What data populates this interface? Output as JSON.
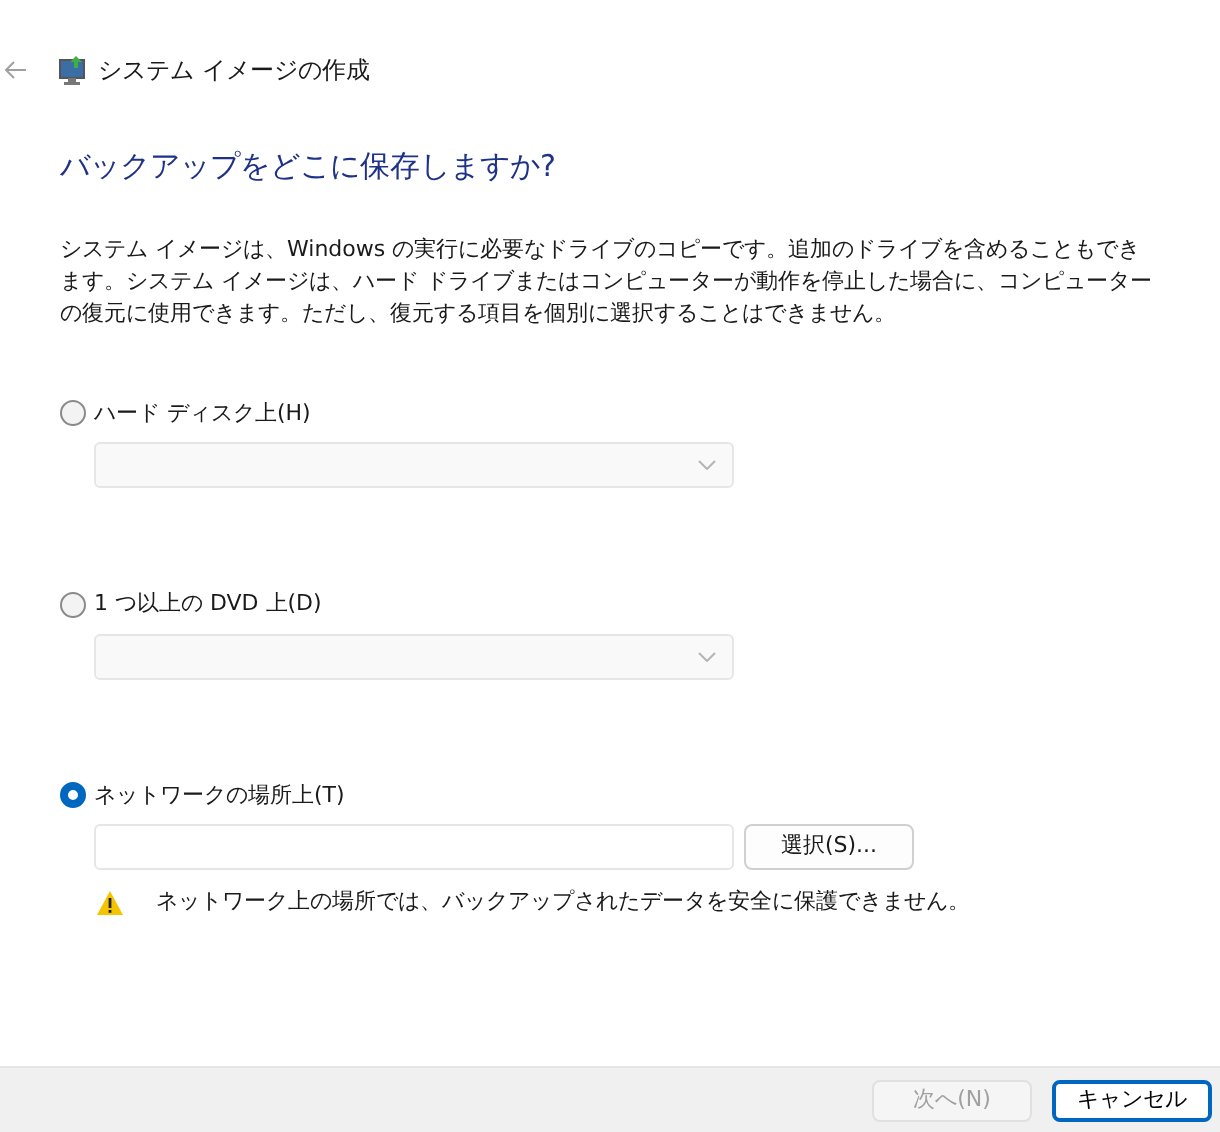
{
  "window": {
    "title": "システム イメージの作成"
  },
  "heading": "バックアップをどこに保存しますか?",
  "description": "システム イメージは、Windows の実行に必要なドライブのコピーです。追加のドライブを含めることもできます。システム イメージは、ハード ドライブまたはコンピューターが動作を停止した場合に、コンピューターの復元に使用できます。ただし、復元する項目を個別に選択することはできません。",
  "options": [
    {
      "label": "ハード ディスク上(H)",
      "selected": false,
      "kind": "dropdown",
      "disabled": true
    },
    {
      "label": "1 つ以上の DVD 上(D)",
      "selected": false,
      "kind": "dropdown",
      "disabled": true
    },
    {
      "label": "ネットワークの場所上(T)",
      "selected": true,
      "kind": "path",
      "button": "選択(S)...",
      "warning": "ネットワーク上の場所では、バックアップされたデータを安全に保護できません。"
    }
  ],
  "footer": {
    "buttons": [
      {
        "label": "次へ(N)",
        "disabled": true,
        "primary": false
      },
      {
        "label": "キャンセル",
        "disabled": false,
        "primary": true
      }
    ]
  }
}
